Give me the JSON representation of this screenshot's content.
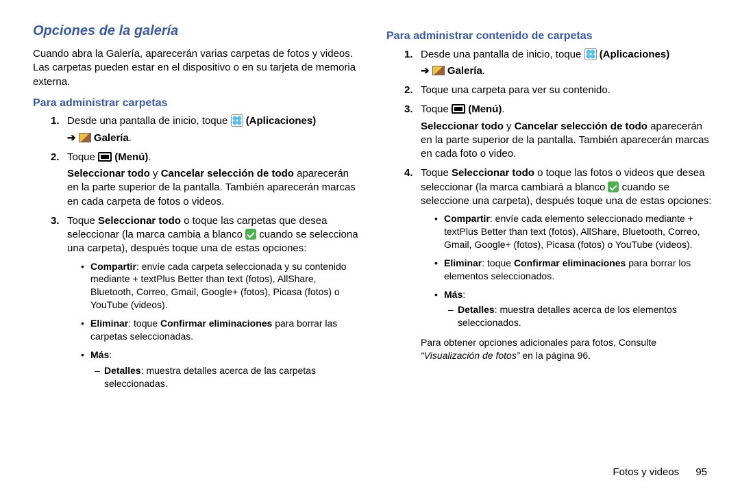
{
  "left": {
    "h2": "Opciones de la galería",
    "intro": "Cuando abra la Galería, aparecerán varias carpetas de fotos y videos. Las carpetas pueden estar en el dispositivo o en su tarjeta de memoria externa.",
    "h3": "Para administrar carpetas",
    "step1_a": "Desde una pantalla de inicio, toque ",
    "step1_apps": "(Aplicaciones)",
    "step1_arrow": "➔",
    "step1_gallery": "Galería",
    "step2_a": "Toque ",
    "step2_menu": "(Menú)",
    "step2_sel_a": "Seleccionar todo",
    "step2_sel_y": " y ",
    "step2_sel_b": "Cancelar selección de todo",
    "step2_tail": " aparecerán en la parte superior de la pantalla. También aparecerán marcas en cada carpeta de fotos o videos.",
    "step3_a": "Toque ",
    "step3_bold": "Seleccionar todo",
    "step3_b": " o toque las carpetas que desea seleccionar (la marca cambia a blanco ",
    "step3_c": " cuando se selecciona una carpeta), después toque una de estas opciones:",
    "bul_compartir_b": "Compartir",
    "bul_compartir_t": ": envíe cada carpeta seleccionada y su contenido mediante + textPlus Better than text (fotos), AllShare, Bluetooth, Correo, Gmail, Google+ (fotos), Picasa (fotos) o YouTube (videos).",
    "bul_eliminar_b": "Eliminar",
    "bul_eliminar_mid": ": toque ",
    "bul_eliminar_conf": "Confirmar eliminaciones",
    "bul_eliminar_tail": " para borrar las carpetas seleccionadas.",
    "bul_mas_b": "Más",
    "dash_detalles_b": "Detalles",
    "dash_detalles_t": ": muestra detalles acerca de las carpetas seleccionadas."
  },
  "right": {
    "h3": "Para administrar contenido de carpetas",
    "step1_a": "Desde una pantalla de inicio, toque ",
    "step1_apps": "(Aplicaciones)",
    "step1_arrow": "➔",
    "step1_gallery": "Galería",
    "step2": "Toque una carpeta para ver su contenido.",
    "step3_a": "Toque ",
    "step3_menu": "(Menú)",
    "step3_sel_a": "Seleccionar todo",
    "step3_sel_y": " y ",
    "step3_sel_b": "Cancelar selección de todo",
    "step3_tail": " aparecerán en la parte superior de la pantalla. También aparecerán marcas en cada foto o video.",
    "step4_a": "Toque ",
    "step4_bold": "Seleccionar todo",
    "step4_b": " o toque las fotos o videos que desea seleccionar (la marca cambiará a blanco ",
    "step4_c": " cuando se seleccione una carpeta), después toque una de estas opciones:",
    "bul_compartir_b": "Compartir",
    "bul_compartir_t": ": envíe cada elemento seleccionado mediante + textPlus Better than text (fotos), AllShare, Bluetooth, Correo, Gmail, Google+ (fotos), Picasa (fotos) o YouTube (videos).",
    "bul_eliminar_b": "Eliminar",
    "bul_eliminar_mid": ": toque ",
    "bul_eliminar_conf": "Confirmar eliminaciones",
    "bul_eliminar_tail": " para borrar los elementos seleccionados.",
    "bul_mas_b": "Más",
    "dash_detalles_b": "Detalles",
    "dash_detalles_t": ": muestra detalles acerca de los elementos seleccionados.",
    "note_a": "Para obtener opciones adicionales para fotos, Consulte ",
    "note_ref": "“Visualización de fotos”",
    "note_b": " en la página 96."
  },
  "footer": {
    "section": "Fotos y videos",
    "page": "95"
  }
}
